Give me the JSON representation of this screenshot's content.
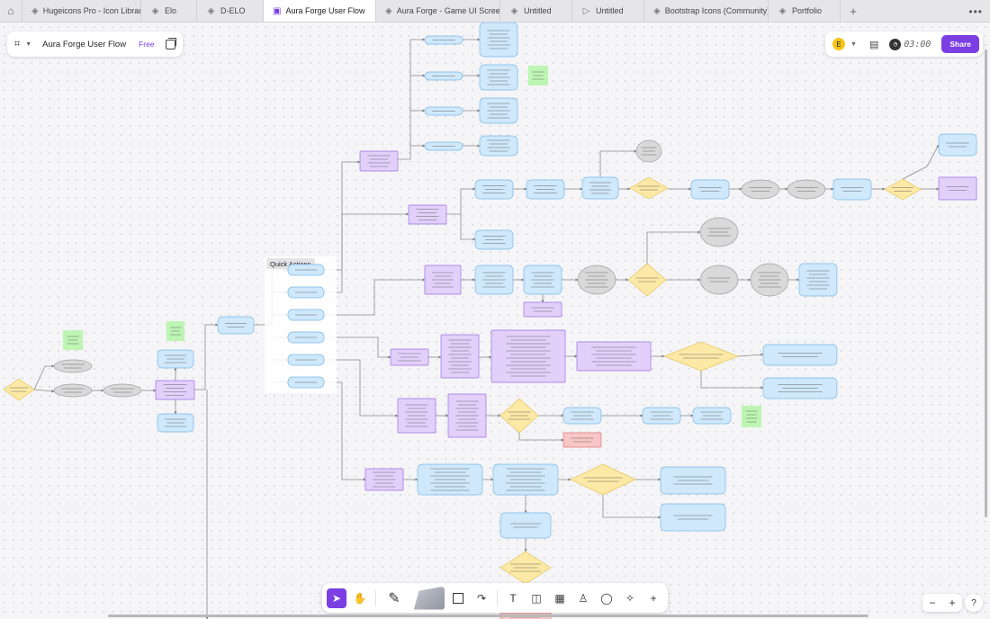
{
  "tabs": [
    {
      "label": "Hugeicons Pro - Icon Library | I",
      "active": false
    },
    {
      "label": "Elo",
      "active": false
    },
    {
      "label": "D-ELO",
      "active": false
    },
    {
      "label": "Aura Forge User Flow",
      "active": true
    },
    {
      "label": "Aura Forge - Game UI Screens",
      "active": false
    },
    {
      "label": "Untitled",
      "active": false
    },
    {
      "label": "Untitled",
      "active": false
    },
    {
      "label": "Bootstrap Icons (Community)",
      "active": false
    },
    {
      "label": "Portfolio",
      "active": false
    }
  ],
  "file": {
    "name": "Aura Forge User Flow",
    "plan": "Free"
  },
  "header": {
    "avatar": "E",
    "timer": "03:00",
    "share_label": "Share"
  },
  "section": {
    "quick_actions": "Quick Actions"
  },
  "colors": {
    "accent": "#7b3fe4",
    "blue_node": "#cfe8fb",
    "blue_border": "#7ab8e8",
    "purple_node": "#e2d0fb",
    "purple_border": "#9b6fe0",
    "gray_node": "#d9d9d9",
    "yellow_node": "#fde9a6",
    "green_note": "#bdf5b3",
    "red_node": "#f8c6c6"
  },
  "icons": {
    "home": "home-icon",
    "figjam": "figjam-icon",
    "close": "close-icon",
    "add": "plus-icon",
    "more": "more-icon",
    "move": "cursor-icon",
    "hand": "hand-icon",
    "pen": "marker-icon",
    "shape": "square-icon",
    "connector": "connector-icon",
    "text": "text-icon",
    "section": "section-icon",
    "table": "table-icon",
    "stamp": "stamp-icon",
    "comment": "comment-icon",
    "ai": "sparkle-icon",
    "more_tools": "plus-icon",
    "zoom_out": "minus-icon",
    "zoom_in": "plus-icon",
    "help": "help-icon"
  }
}
